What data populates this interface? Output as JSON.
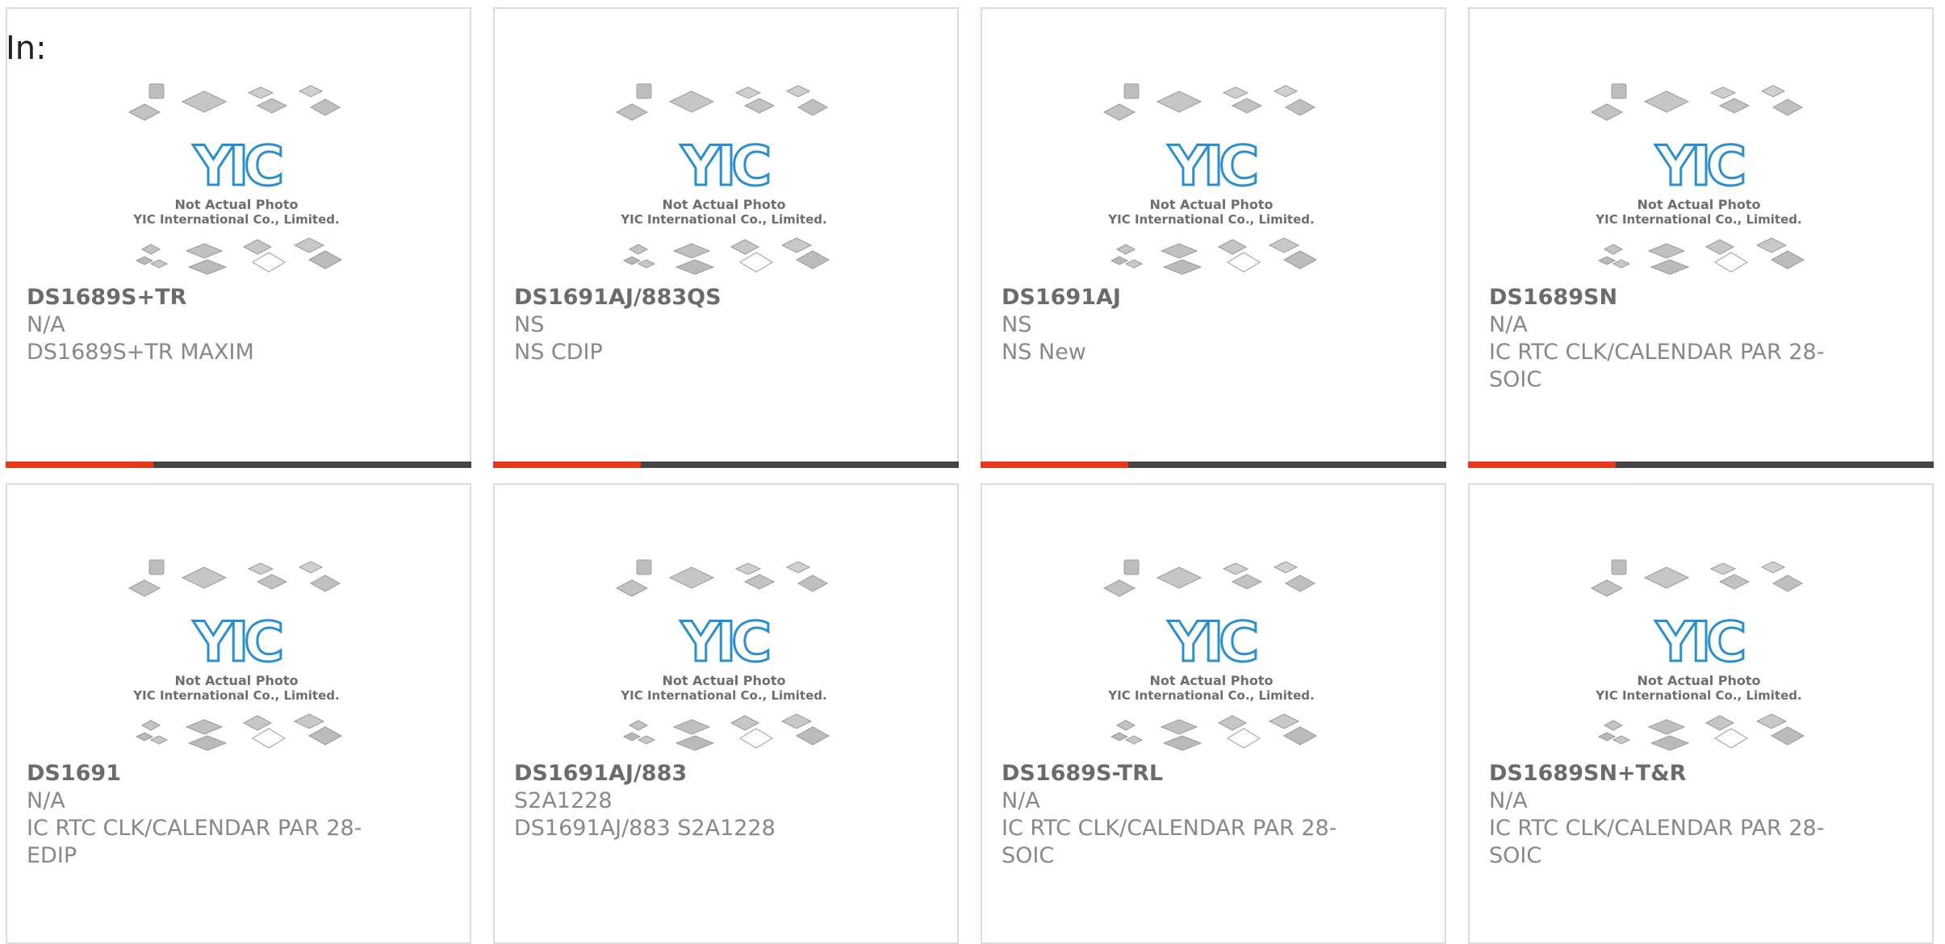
{
  "page": {
    "label": "In:"
  },
  "image": {
    "caption_line1": "Not Actual Photo",
    "caption_line2": "YIC International Co., Limited.",
    "logo_text": "YIC"
  },
  "colors": {
    "accent": "#e43a1b",
    "bar": "#444444",
    "logo_blue": "#2a8fd0",
    "text": "#888888"
  },
  "products": [
    {
      "part_number": "DS1689S+TR",
      "manufacturer": "N/A",
      "description": "DS1689S+TR MAXIM"
    },
    {
      "part_number": "DS1691AJ/883QS",
      "manufacturer": "NS",
      "description": "NS CDIP"
    },
    {
      "part_number": "DS1691AJ",
      "manufacturer": "NS",
      "description": "NS New"
    },
    {
      "part_number": "DS1689SN",
      "manufacturer": "N/A",
      "description": "IC RTC CLK/CALENDAR PAR 28-SOIC"
    },
    {
      "part_number": "DS1691",
      "manufacturer": "N/A",
      "description": "IC RTC CLK/CALENDAR PAR 28-EDIP"
    },
    {
      "part_number": "DS1691AJ/883",
      "manufacturer": "S2A1228",
      "description": "DS1691AJ/883 S2A1228"
    },
    {
      "part_number": "DS1689S-TRL",
      "manufacturer": "N/A",
      "description": "IC RTC CLK/CALENDAR PAR 28-SOIC"
    },
    {
      "part_number": "DS1689SN+T&R",
      "manufacturer": "N/A",
      "description": "IC RTC CLK/CALENDAR PAR 28-SOIC"
    }
  ]
}
